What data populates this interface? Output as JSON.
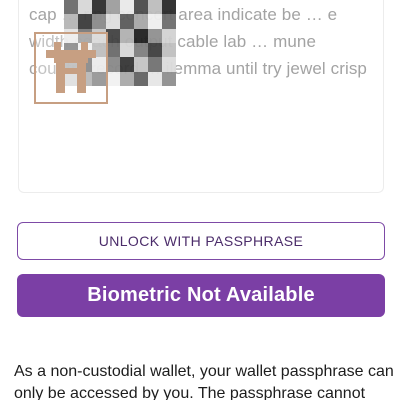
{
  "recovery_phrase": {
    "text": "cap … ring concert area indicate be … e width coach output cable lab … mune country record … ilemma until try jewel crisp",
    "qr_code": "blurred-qr-code",
    "logo": "castle-logo"
  },
  "buttons": {
    "unlock_label": "UNLOCK WITH PASSPHRASE",
    "biometric_label": "Biometric Not Available"
  },
  "info": {
    "text": "As a non-custodial wallet, your wallet passphrase can only be accessed by you. The passphrase cannot"
  },
  "colors": {
    "accent": "#7b3fa5",
    "outline": "#7d4aa6",
    "logo": "#c79f82",
    "muted_text": "#a3a3a3"
  }
}
